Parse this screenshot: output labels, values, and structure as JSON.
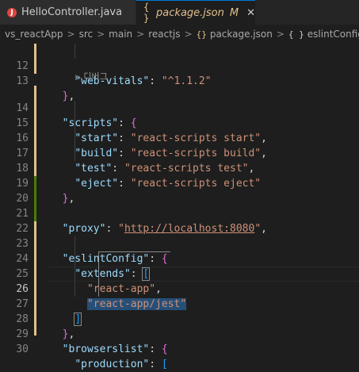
{
  "tabs": [
    {
      "icon": "J",
      "label": "HelloController.java"
    },
    {
      "icon": "{ }",
      "label": "package.json",
      "modified": "M",
      "close": "✕"
    }
  ],
  "breadcrumb": {
    "items": [
      "vs_reactApp",
      "src",
      "main",
      "reactjs",
      "package.json",
      "eslintConfig",
      "["
    ],
    "separator": ">"
  },
  "codelens": "디버그",
  "lines": [
    {
      "num": "12"
    },
    {
      "num": "13"
    },
    {
      "num": "14"
    },
    {
      "num": "15"
    },
    {
      "num": "16"
    },
    {
      "num": "17"
    },
    {
      "num": "18"
    },
    {
      "num": "19"
    },
    {
      "num": "20"
    },
    {
      "num": "21"
    },
    {
      "num": "22"
    },
    {
      "num": "23"
    },
    {
      "num": "24"
    },
    {
      "num": "25"
    },
    {
      "num": "26"
    },
    {
      "num": "27"
    },
    {
      "num": "28"
    },
    {
      "num": "29"
    },
    {
      "num": "30"
    }
  ],
  "code": {
    "webvitals_key": "\"web-vitals\"",
    "webvitals_val": "\"^1.1.2\"",
    "scripts_key": "\"scripts\"",
    "start_key": "\"start\"",
    "start_val": "\"react-scripts start\"",
    "build_key": "\"build\"",
    "build_val": "\"react-scripts build\"",
    "test_key": "\"test\"",
    "test_val": "\"react-scripts test\"",
    "eject_key": "\"eject\"",
    "eject_val": "\"react-scripts eject\"",
    "proxy_key": "\"proxy\"",
    "proxy_q": "\"",
    "proxy_url": "http://localhost:8080",
    "eslint_key": "\"eslintConfig\"",
    "extends_key": "\"extends\"",
    "ext1": "\"react-app\"",
    "ext2": "\"react-app/jest\"",
    "browsers_key": "\"browserslist\"",
    "production_key": "\"production\""
  },
  "colors": {
    "modified_gutter": "#e2c08d",
    "added_gutter": "#487e02",
    "accent": "#0078d4"
  }
}
